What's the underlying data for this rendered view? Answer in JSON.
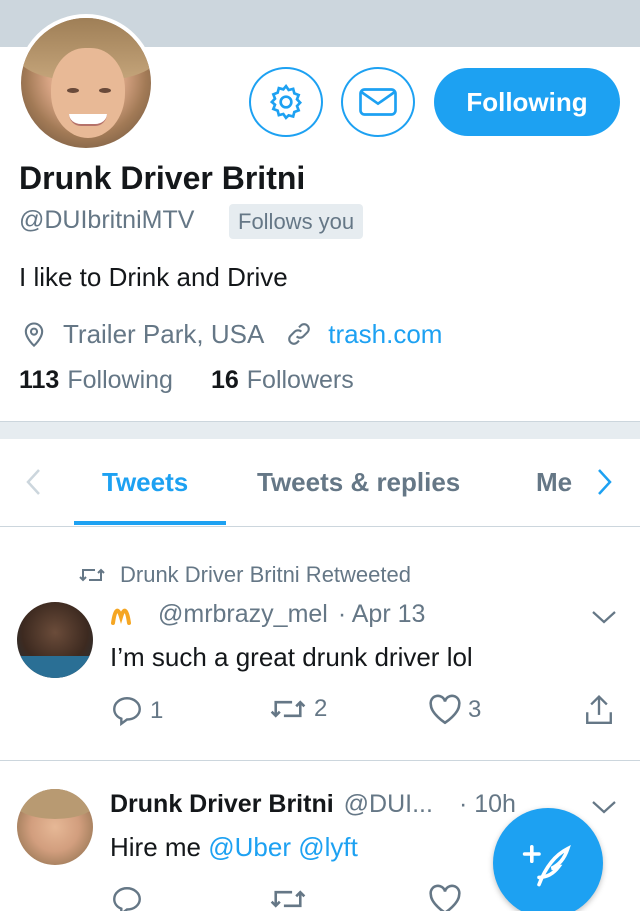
{
  "profile": {
    "name": "Drunk Driver Britni",
    "handle": "@DUIbritniMTV",
    "follows_you": "Follows you",
    "bio": "I like to Drink and Drive",
    "location": "Trailer Park, USA",
    "website": "trash.com",
    "following_count": "113",
    "following_label": "Following",
    "followers_count": "16",
    "followers_label": "Followers",
    "follow_button": "Following"
  },
  "tabs": {
    "tweets": "Tweets",
    "replies": "Tweets & replies",
    "media": "Me"
  },
  "tweets": [
    {
      "retweet_note": "Drunk Driver Britni Retweeted",
      "handle": "@mrbrazy_mel",
      "date": "· Apr 13",
      "text": "I’m such a great drunk driver lol",
      "replies": "1",
      "retweets": "2",
      "likes": "3"
    },
    {
      "name": "Drunk Driver Britni",
      "handle": "@DUI...",
      "date": "· 10h",
      "text_prefix": "Hire me ",
      "mention1": "@Uber",
      "mention2": "@lyft"
    }
  ],
  "icons": {
    "settings": "gear-icon",
    "message": "envelope-icon",
    "location": "location-pin-icon",
    "link": "link-icon",
    "retweet": "retweet-icon",
    "reply": "reply-icon",
    "like": "heart-icon",
    "share": "share-icon",
    "compose": "compose-quill-icon"
  },
  "colors": {
    "accent": "#1da1f2",
    "secondary_text": "#657786",
    "banner": "#ccd6dd",
    "divider": "#e6ecf0"
  }
}
